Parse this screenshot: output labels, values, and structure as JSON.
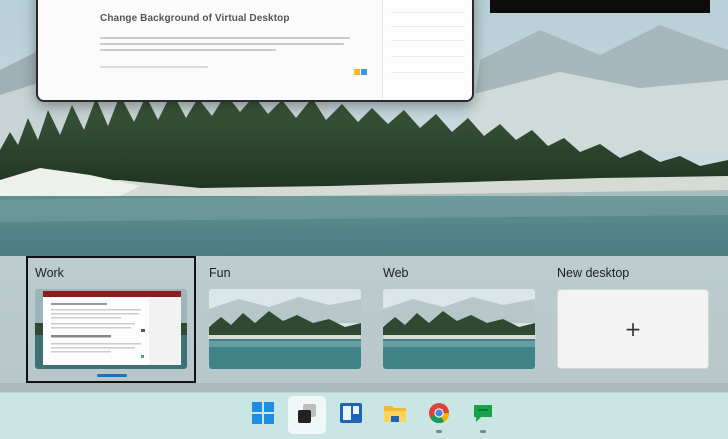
{
  "window_preview": {
    "title": "Change Background of Virtual Desktop"
  },
  "desktops": [
    {
      "name": "Work",
      "selected": true
    },
    {
      "name": "Fun",
      "selected": false
    },
    {
      "name": "Web",
      "selected": false
    }
  ],
  "new_desktop": {
    "label": "New desktop",
    "icon": "+"
  },
  "taskbar": {
    "items": [
      {
        "icon": "windows-start-icon",
        "active": false
      },
      {
        "icon": "task-view-icon",
        "active": true
      },
      {
        "icon": "widgets-icon",
        "active": false
      },
      {
        "icon": "file-explorer-icon",
        "active": false
      },
      {
        "icon": "chrome-icon",
        "active": false,
        "running": true
      },
      {
        "icon": "chat-icon",
        "active": false,
        "running": true
      }
    ]
  },
  "colors": {
    "selection_indicator": "#1f6fc9",
    "taskbar_bg": "#c9e6e5"
  }
}
